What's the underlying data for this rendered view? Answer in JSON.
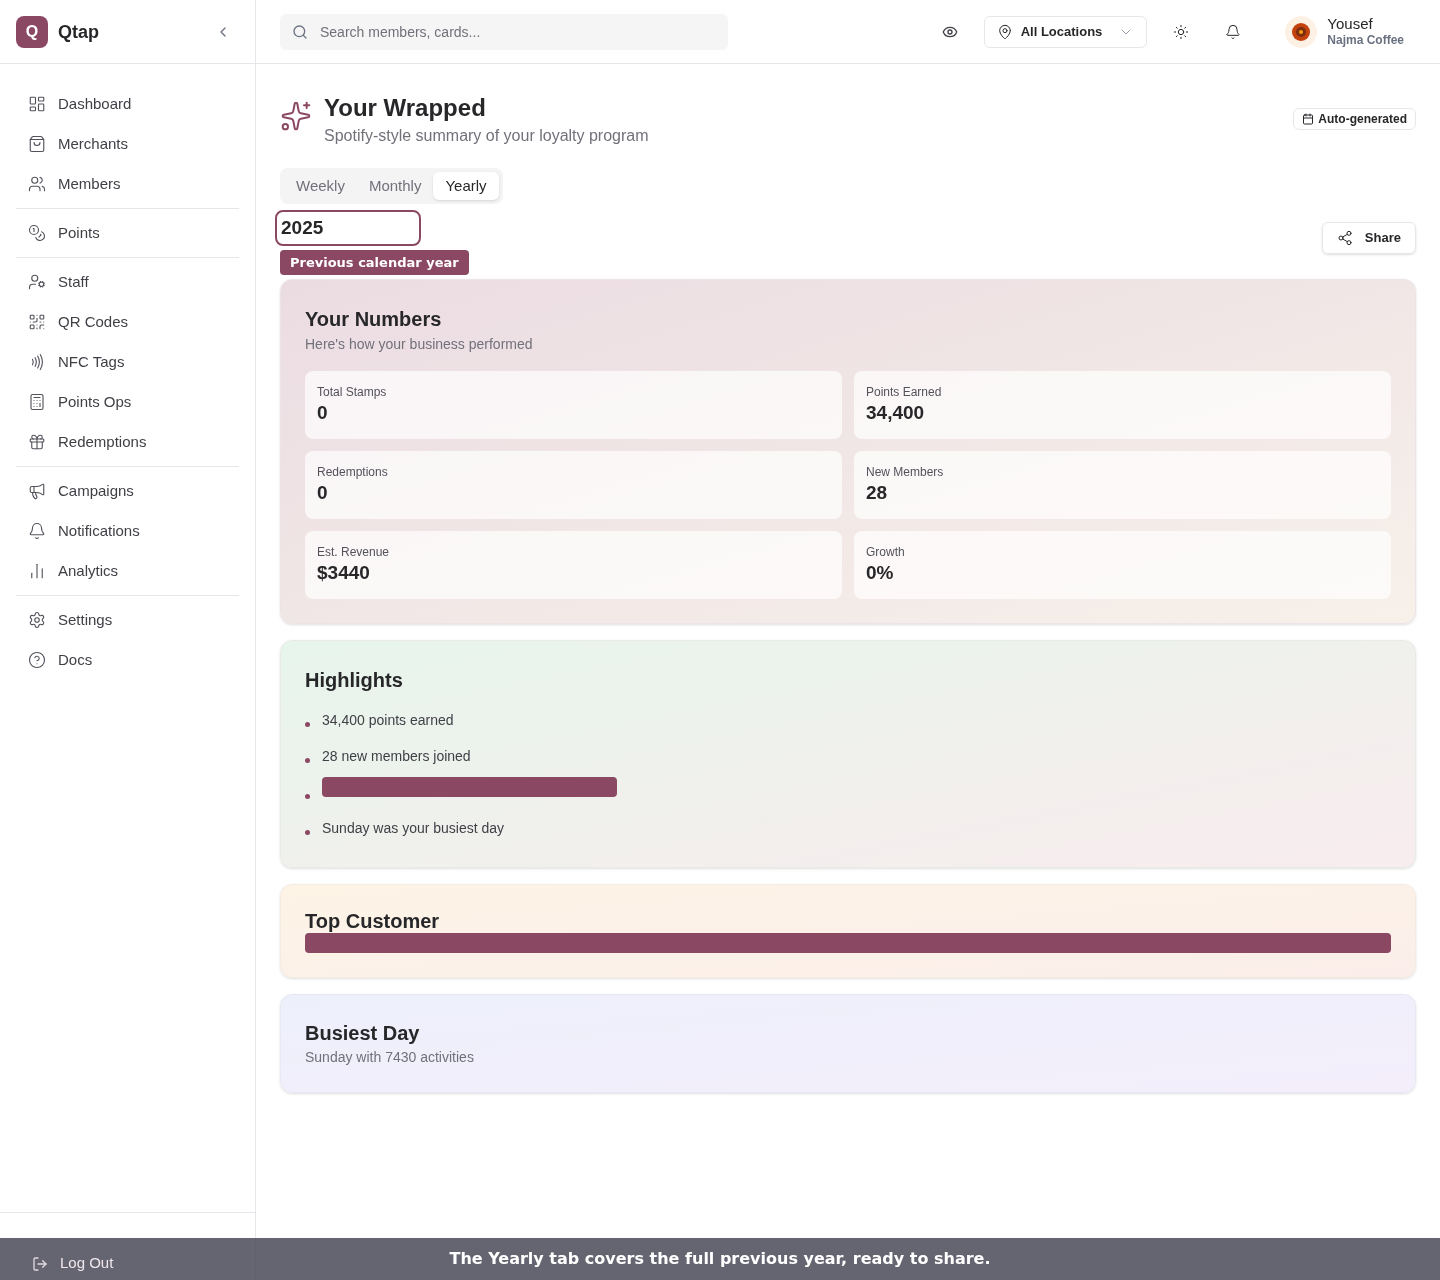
{
  "brand": {
    "logo_letter": "Q",
    "name": "Qtap"
  },
  "sidebar": {
    "groups": [
      {
        "items": [
          {
            "label": "Dashboard"
          },
          {
            "label": "Merchants"
          },
          {
            "label": "Members"
          }
        ]
      },
      {
        "items": [
          {
            "label": "Points"
          }
        ]
      },
      {
        "items": [
          {
            "label": "Staff"
          },
          {
            "label": "QR Codes"
          },
          {
            "label": "NFC Tags"
          },
          {
            "label": "Points Ops"
          },
          {
            "label": "Redemptions"
          }
        ]
      },
      {
        "items": [
          {
            "label": "Campaigns"
          },
          {
            "label": "Notifications"
          },
          {
            "label": "Analytics"
          }
        ]
      },
      {
        "items": [
          {
            "label": "Settings"
          },
          {
            "label": "Docs"
          }
        ]
      }
    ],
    "logout": "Log Out"
  },
  "header": {
    "search": {
      "placeholder": "Search members, cards..."
    },
    "location": "All Locations",
    "user": {
      "name": "Yousef",
      "business": "Najma Coffee"
    }
  },
  "page": {
    "title": "Your Wrapped",
    "subtitle": "Spotify-style summary of your loyalty program",
    "badge": "Auto-generated"
  },
  "tabs": [
    {
      "label": "Weekly",
      "selected": false
    },
    {
      "label": "Monthly",
      "selected": false
    },
    {
      "label": "Yearly",
      "selected": true
    }
  ],
  "period": {
    "value": "2025",
    "tooltip": "Previous calendar year"
  },
  "share": "Share",
  "numbers": {
    "title": "Your Numbers",
    "subtitle": "Here's how your business performed",
    "stats": [
      {
        "label": "Total Stamps",
        "value": "0"
      },
      {
        "label": "Points Earned",
        "value": "34,400"
      },
      {
        "label": "Redemptions",
        "value": "0"
      },
      {
        "label": "New Members",
        "value": "28"
      },
      {
        "label": "Est. Revenue",
        "value": "$3440"
      },
      {
        "label": "Growth",
        "value": "0%"
      }
    ]
  },
  "highlights": {
    "title": "Highlights",
    "items": [
      {
        "kind": "text",
        "text": "34,400 points earned"
      },
      {
        "kind": "text",
        "text": "28 new members joined"
      },
      {
        "kind": "redacted"
      },
      {
        "kind": "text",
        "text": "Sunday was your busiest day"
      }
    ]
  },
  "top_customer": {
    "title": "Top Customer",
    "kind": "redacted"
  },
  "busiest_day": {
    "title": "Busiest Day",
    "text": "Sunday with 7430 activities"
  },
  "banner": "The Yearly tab covers the full previous year, ready to share."
}
